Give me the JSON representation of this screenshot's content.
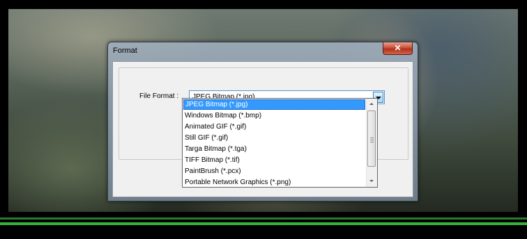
{
  "dialog": {
    "title": "Format",
    "close_icon": "close-icon",
    "close_glyph": "✕"
  },
  "file_format": {
    "label": "File Format :",
    "selected": "JPEG Bitmap (*.jpg)",
    "options": [
      "JPEG Bitmap (*.jpg)",
      "Windows Bitmap (*.bmp)",
      "Animated GIF (*.gif)",
      "Still GIF (*.gif)",
      "Targa Bitmap (*.tga)",
      "TIFF Bitmap (*.tif)",
      "PaintBrush (*.pcx)",
      "Portable Network Graphics (*.png)"
    ],
    "highlighted_index": 0
  },
  "colors": {
    "selection": "#3399ff",
    "progress_green": "#35b43b"
  }
}
